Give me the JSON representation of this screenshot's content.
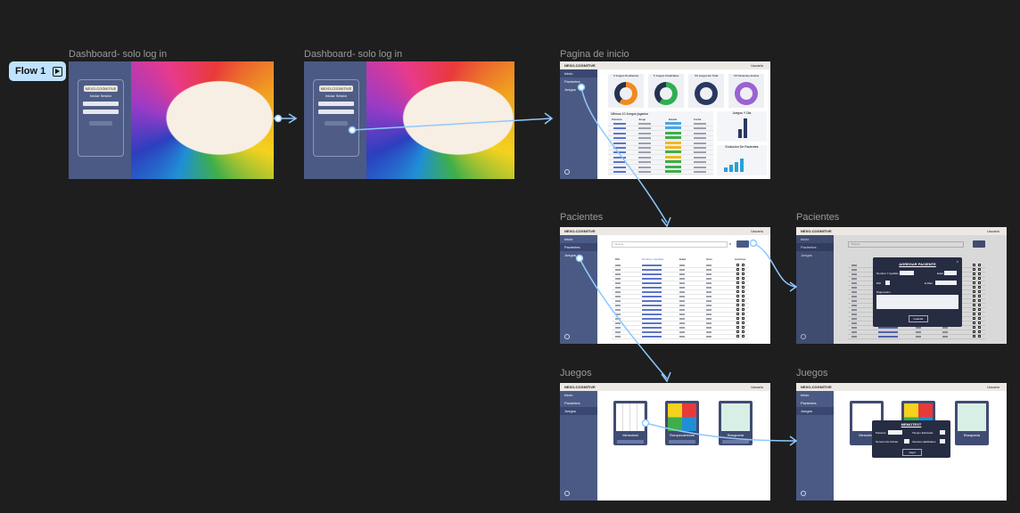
{
  "flow": {
    "label": "Flow 1"
  },
  "frames": {
    "login1": {
      "title": "Dashboard- solo log in"
    },
    "login2": {
      "title": "Dashboard- solo log in"
    },
    "inicio": {
      "title": "Pagina de inicio"
    },
    "pacientes1": {
      "title": "Pacientes"
    },
    "pacientes2": {
      "title": "Pacientes"
    },
    "juegos1": {
      "title": "Juegos"
    },
    "juegos2": {
      "title": "Juegos"
    }
  },
  "app": {
    "brand": "NEXO-COGNITIVE",
    "user": "Usuario",
    "nav": [
      "Inicio",
      "Pacientes",
      "Juegos"
    ]
  },
  "login": {
    "card_title": "NEXO-COGNITIVE",
    "subtitle": "Iniciar Sesión"
  },
  "inicio": {
    "stats": [
      "X Juegos Pendientes",
      "X Juegos Finalizados",
      "XX Juegos En Total",
      "XX Pacientes Activos"
    ],
    "recent_title": "Últimos 10 Juegos jugados",
    "headers": [
      "Paciente",
      "Juego",
      "Estado",
      "Fecha"
    ],
    "side_charts": [
      "Juegos Y Dia",
      "Evolución De Pacientes"
    ]
  },
  "pacientes": {
    "search_placeholder": "Buscar...",
    "headers": [
      "DNI",
      "Nombre y Apellido",
      "Edad",
      "Sexo",
      "Acciones"
    ],
    "modal": {
      "title": "AGREGAR PACIENTE",
      "fields": [
        "Nombre Y Apellido",
        "Edad",
        "DNI",
        "E-Mail",
        "Diagnostico"
      ],
      "button": "Guardar"
    }
  },
  "juegos": {
    "cards": [
      "Memotest",
      "Rompecabezas",
      "Búsqueda"
    ],
    "modal": {
      "title": "MEMOTEST",
      "fields": [
        "Paciente",
        "Tiempo Estimado",
        "Numero De Fichas",
        "Intentos Habilitados"
      ],
      "button": "Jugar"
    }
  },
  "colors": {
    "sidebar": "#4b5a84",
    "connector": "#8fc9ff",
    "canvas": "#1e1e1e"
  }
}
